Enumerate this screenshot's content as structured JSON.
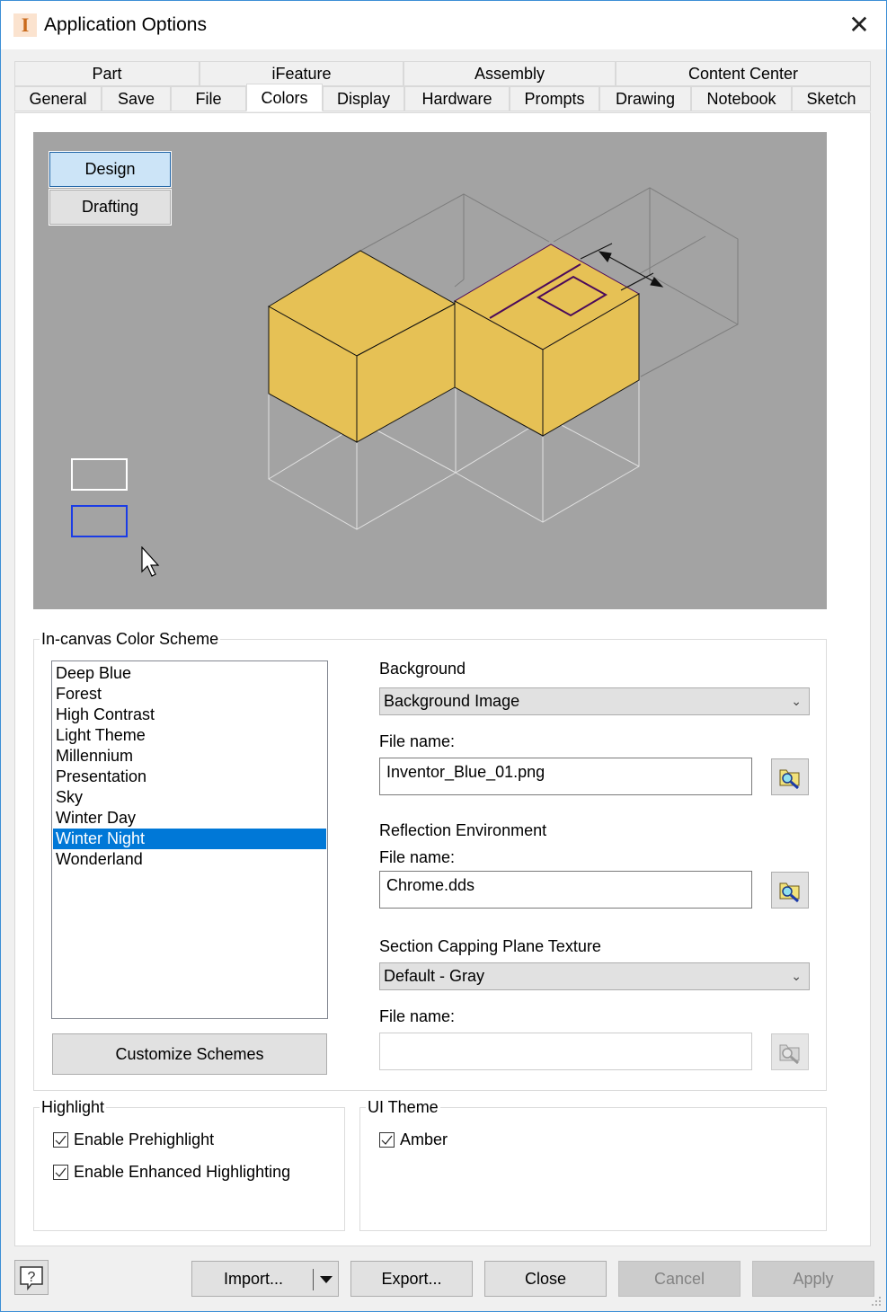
{
  "window": {
    "title": "Application Options",
    "close_icon": "close-icon",
    "app_icon_glyph": "I"
  },
  "tabs": {
    "top_row": [
      {
        "label": "Part"
      },
      {
        "label": "iFeature"
      },
      {
        "label": "Assembly"
      },
      {
        "label": "Content Center"
      }
    ],
    "bottom_row": [
      {
        "label": "General"
      },
      {
        "label": "Save"
      },
      {
        "label": "File"
      },
      {
        "label": "Colors",
        "active": true
      },
      {
        "label": "Display"
      },
      {
        "label": "Hardware"
      },
      {
        "label": "Prompts"
      },
      {
        "label": "Drawing"
      },
      {
        "label": "Notebook"
      },
      {
        "label": "Sketch"
      }
    ]
  },
  "preview": {
    "modes": [
      {
        "label": "Design",
        "selected": true
      },
      {
        "label": "Drafting",
        "selected": false
      }
    ],
    "background_color": "#a3a3a3",
    "part_color": "#e6c155",
    "sketch_color": "#4b0a5a",
    "selection_box_color": "#1a3ce6"
  },
  "color_scheme": {
    "group_label": "In-canvas Color Scheme",
    "schemes": [
      {
        "label": "Deep Blue"
      },
      {
        "label": "Forest"
      },
      {
        "label": "High Contrast"
      },
      {
        "label": "Light Theme"
      },
      {
        "label": "Millennium"
      },
      {
        "label": "Presentation"
      },
      {
        "label": "Sky"
      },
      {
        "label": "Winter Day"
      },
      {
        "label": "Winter Night",
        "selected": true
      },
      {
        "label": "Wonderland"
      }
    ],
    "customize_label": "Customize Schemes",
    "background": {
      "label": "Background",
      "selected": "Background Image",
      "file_label": "File name:",
      "file_value": "Inventor_Blue_01.png"
    },
    "reflection": {
      "label": "Reflection Environment",
      "file_label": "File name:",
      "file_value": "Chrome.dds"
    },
    "section_capping": {
      "label": "Section Capping Plane Texture",
      "selected": "Default - Gray",
      "file_label": "File name:",
      "file_value": ""
    }
  },
  "highlight": {
    "group_label": "Highlight",
    "options": [
      {
        "label": "Enable Prehighlight",
        "checked": true
      },
      {
        "label": "Enable Enhanced Highlighting",
        "checked": true
      }
    ]
  },
  "ui_theme": {
    "group_label": "UI Theme",
    "options": [
      {
        "label": "Amber",
        "checked": true
      }
    ]
  },
  "footer": {
    "help_glyph": "?",
    "import_label": "Import...",
    "export_label": "Export...",
    "close_label": "Close",
    "cancel_label": "Cancel",
    "apply_label": "Apply"
  }
}
